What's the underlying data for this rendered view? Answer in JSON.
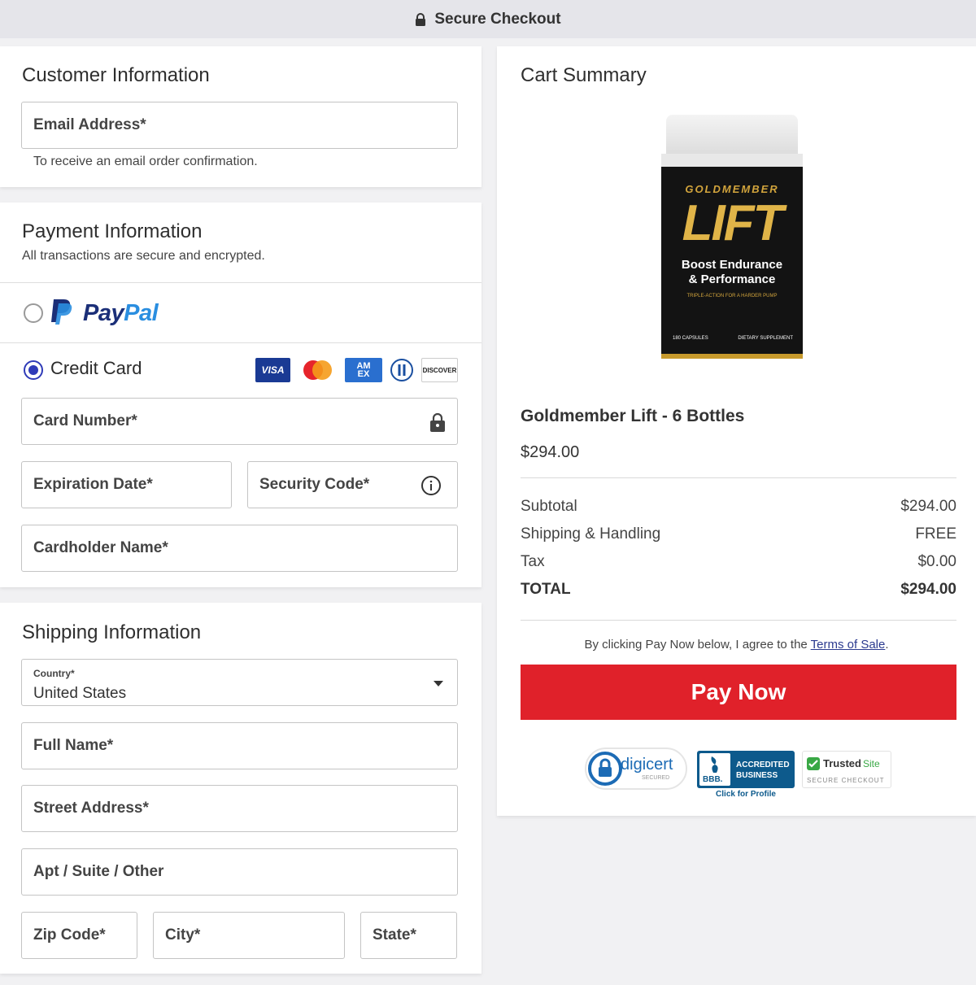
{
  "header": {
    "title": "Secure Checkout"
  },
  "customer": {
    "title": "Customer Information",
    "email_label": "Email Address*",
    "email_hint": "To receive an email order confirmation."
  },
  "payment": {
    "title": "Payment Information",
    "subtitle": "All transactions are secure and encrypted.",
    "paypal_label": "PayPal",
    "paypal_pay": "Pay",
    "paypal_pal": "Pal",
    "credit_card_label": "Credit Card",
    "card_brands": [
      "VISA",
      "Mastercard",
      "AMEX",
      "Diners Club",
      "DISCOVER"
    ],
    "visa_text": "VISA",
    "amex_text": "AM EX",
    "discover_text": "DISCOVER",
    "card_number_label": "Card Number*",
    "expiration_label": "Expiration Date*",
    "security_code_label": "Security Code*",
    "cardholder_label": "Cardholder Name*",
    "selected_method": "Credit Card"
  },
  "shipping": {
    "title": "Shipping Information",
    "country_label": "Country*",
    "country_value": "United States",
    "full_name_label": "Full Name*",
    "street_label": "Street Address*",
    "apt_label": "Apt / Suite / Other",
    "zip_label": "Zip Code*",
    "city_label": "City*",
    "state_label": "State*"
  },
  "cart": {
    "title": "Cart Summary",
    "product": {
      "brand_line": "GOLDMEMBER",
      "big_word": "LIFT",
      "tagline_1": "Boost Endurance",
      "tagline_2": "& Performance",
      "small_line": "TRIPLE-ACTION FOR A HARDER PUMP",
      "capsules": "180 CAPSULES",
      "supplement": "DIETARY SUPPLEMENT"
    },
    "product_name": "Goldmember Lift - 6 Bottles",
    "product_price": "$294.00",
    "rows": [
      {
        "label": "Subtotal",
        "value": "$294.00"
      },
      {
        "label": "Shipping & Handling",
        "value": "FREE"
      },
      {
        "label": "Tax",
        "value": "$0.00"
      },
      {
        "label": "TOTAL",
        "value": "$294.00"
      }
    ],
    "agree_text": "By clicking Pay Now below, I agree to the ",
    "terms_link": "Terms of Sale",
    "agree_end": ".",
    "pay_button": "Pay Now",
    "badges": {
      "digicert": "digicert",
      "digicert_sub": "SECURED",
      "bbb_line1": "ACCREDITED",
      "bbb_line2": "BUSINESS",
      "bbb_mark": "BBB.",
      "bbb_link": "Click for Profile",
      "trusted_a": "Trusted",
      "trusted_b": "Site",
      "trusted_sub": "SECURE CHECKOUT"
    }
  },
  "colors": {
    "accent_blue": "#2f3bb8",
    "pay_button": "#e0212a",
    "paypal_dark": "#1b2f78",
    "paypal_light": "#2a8ee0"
  }
}
